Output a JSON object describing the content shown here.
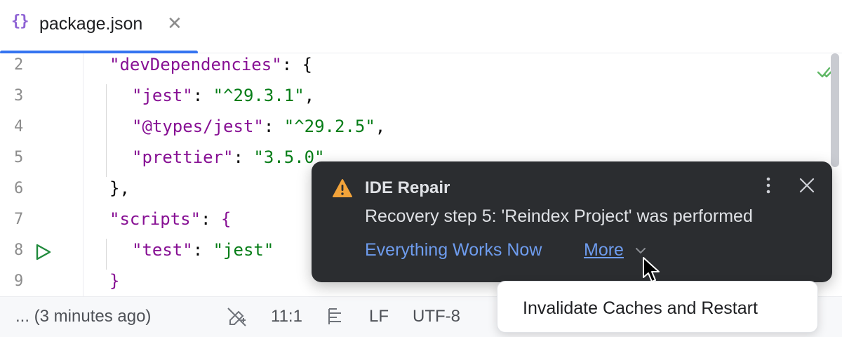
{
  "tab": {
    "icon": "{}",
    "label": "package.json",
    "close": "✕"
  },
  "editor": {
    "lines": [
      {
        "num": "2",
        "p1": "\"devDependencies\"",
        "p2": ": {",
        "p3": ""
      },
      {
        "num": "3",
        "p1": "\"jest\"",
        "p2": ": ",
        "p3": "\"^29.3.1\"",
        "p4": ","
      },
      {
        "num": "4",
        "p1": "\"@types/jest\"",
        "p2": ": ",
        "p3": "\"^29.2.5\"",
        "p4": ","
      },
      {
        "num": "5",
        "p1": "\"prettier\"",
        "p2": ": ",
        "p3": "\"3.5.0\""
      },
      {
        "num": "6",
        "p1": "},"
      },
      {
        "num": "7",
        "p1": "\"scripts\"",
        "p2": ": ",
        "p3": "{"
      },
      {
        "num": "8",
        "p1": "\"test\"",
        "p2": ": ",
        "p3": "\"jest\""
      },
      {
        "num": "9",
        "p1": "}"
      }
    ],
    "icons": {
      "run": "run-icon",
      "inspection": "checkmark-icon"
    }
  },
  "statusbar": {
    "vcs": "... (3 minutes ago)",
    "position": "11:1",
    "line_separator": "LF",
    "encoding": "UTF-8"
  },
  "notification": {
    "title": "IDE Repair",
    "message": "Recovery step 5: 'Reindex Project' was performed",
    "action": "Everything Works Now",
    "more": "More",
    "icons": {
      "warning": "warning-icon",
      "menu": "kebab-menu-icon",
      "close": "close-icon"
    }
  },
  "popup": {
    "item": "Invalidate Caches and Restart"
  },
  "colors": {
    "accent": "#3574f0",
    "notification_bg": "#2b2d30",
    "link": "#6e9cee",
    "json_key": "#871094",
    "json_string": "#067d17",
    "warning": "#f2a33a"
  }
}
